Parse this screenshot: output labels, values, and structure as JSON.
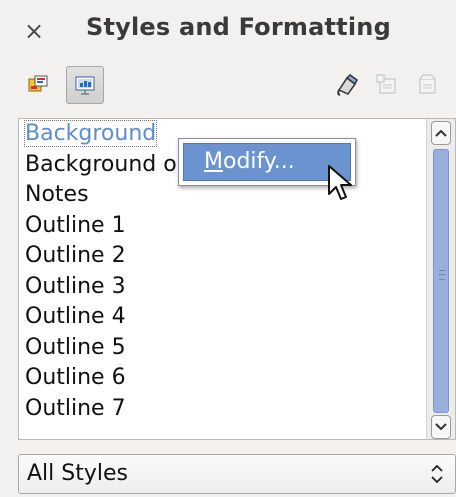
{
  "panel": {
    "close_glyph": "×",
    "title": "Styles and Formatting"
  },
  "toolbar": {
    "left_buttons": [
      {
        "icon": "paragraph-styles-icon",
        "pressed": false
      },
      {
        "icon": "presentation-styles-icon",
        "pressed": true
      }
    ],
    "right_buttons": [
      {
        "icon": "fill-format-mode-icon",
        "enabled": true
      },
      {
        "icon": "new-style-from-selection-icon",
        "enabled": false
      },
      {
        "icon": "update-style-icon",
        "enabled": false
      }
    ]
  },
  "styles_list": {
    "items": [
      "Background",
      "Background objects",
      "Notes",
      "Outline 1",
      "Outline 2",
      "Outline 3",
      "Outline 4",
      "Outline 5",
      "Outline 6",
      "Outline 7"
    ],
    "selected_index": 0
  },
  "context_menu": {
    "items": [
      {
        "label_mnemonic": "M",
        "label_rest": "odify...",
        "highlighted": true
      }
    ]
  },
  "filter": {
    "selected": "All Styles"
  },
  "colors": {
    "selection_text": "#5e8ccf",
    "menu_highlight": "#6b93cf",
    "scroll_thumb": "#9ab0dc",
    "panel_bg": "#f2f1f0"
  }
}
